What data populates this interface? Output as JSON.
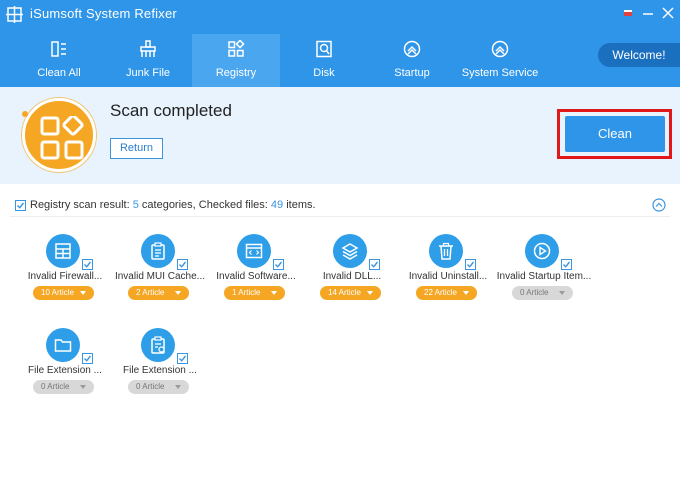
{
  "window": {
    "title": "iSumsoft System Refixer"
  },
  "nav": {
    "items": [
      {
        "label": "Clean All",
        "icon": "clean-all-icon"
      },
      {
        "label": "Junk File",
        "icon": "broom-icon"
      },
      {
        "label": "Registry",
        "icon": "registry-icon",
        "active": true
      },
      {
        "label": "Disk",
        "icon": "disk-icon"
      },
      {
        "label": "Startup",
        "icon": "startup-icon"
      },
      {
        "label": "System Service",
        "icon": "service-icon"
      }
    ],
    "welcome": "Welcome!"
  },
  "header": {
    "title": "Scan completed",
    "return_label": "Return",
    "clean_label": "Clean"
  },
  "summary": {
    "prefix": "Registry scan result:",
    "categories": "5",
    "mid": "categories, Checked files:",
    "files": "49",
    "suffix": "items."
  },
  "categories": [
    {
      "label": "Invalid Firewall...",
      "count": "10 Article",
      "icon": "firewall-icon",
      "checked": true
    },
    {
      "label": "Invalid MUI Cache...",
      "count": "2 Article",
      "icon": "clipboard-icon",
      "checked": true
    },
    {
      "label": "Invalid Software...",
      "count": "1 Article",
      "icon": "software-window-icon",
      "checked": true
    },
    {
      "label": "Invalid DLL...",
      "count": "14 Article",
      "icon": "layers-icon",
      "checked": true
    },
    {
      "label": "Invalid Uninstall...",
      "count": "22 Article",
      "icon": "trash-icon",
      "checked": true
    },
    {
      "label": "Invalid Startup Item...",
      "count": "0 Article",
      "icon": "play-icon",
      "checked": true
    },
    {
      "label": "File Extension ...",
      "count": "0 Article",
      "icon": "folder-icon",
      "checked": true
    },
    {
      "label": "File Extension ...",
      "count": "0 Article",
      "icon": "file-settings-icon",
      "checked": true
    }
  ],
  "colors": {
    "primary": "#2e95e8",
    "accent_orange": "#f5a623",
    "highlight_red": "#e01818",
    "header_bg": "#e8f3fd"
  }
}
